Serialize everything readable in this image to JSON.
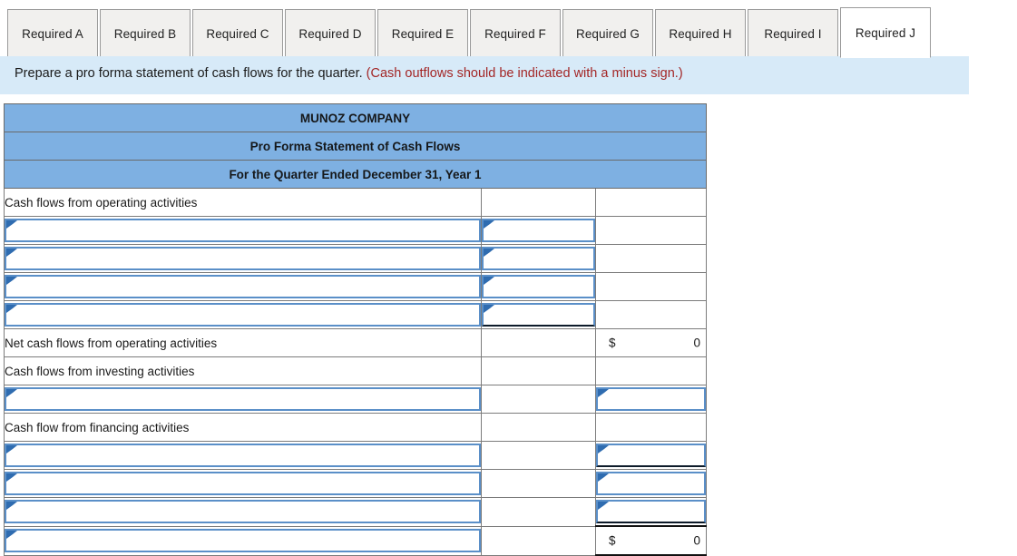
{
  "tabs": {
    "items": [
      {
        "label": "Required A",
        "active": false
      },
      {
        "label": "Required B",
        "active": false
      },
      {
        "label": "Required C",
        "active": false
      },
      {
        "label": "Required D",
        "active": false
      },
      {
        "label": "Required E",
        "active": false
      },
      {
        "label": "Required F",
        "active": false
      },
      {
        "label": "Required G",
        "active": false
      },
      {
        "label": "Required H",
        "active": false
      },
      {
        "label": "Required I",
        "active": false
      },
      {
        "label": "Required J",
        "active": true
      }
    ]
  },
  "instruction": {
    "text": "Prepare a pro forma statement of cash flows for the quarter. ",
    "note": "(Cash outflows should be indicated with a minus sign.)",
    "note_color": "#a32626",
    "background": "#d7eaf8"
  },
  "worksheet": {
    "header_color": "#7eb0e2",
    "titles": [
      "MUNOZ COMPANY",
      "Pro Forma Statement of Cash Flows",
      "For the Quarter Ended December 31, Year 1"
    ],
    "rows": [
      {
        "label": "Cash flows from operating activities",
        "kind": "text",
        "mid": "",
        "right": ""
      },
      {
        "label": "",
        "kind": "input",
        "mid": "input",
        "right": ""
      },
      {
        "label": "",
        "kind": "input",
        "mid": "input",
        "right": ""
      },
      {
        "label": "",
        "kind": "input",
        "mid": "input",
        "right": ""
      },
      {
        "label": "",
        "kind": "input",
        "mid": "input-last",
        "right": ""
      },
      {
        "label": "Net cash flows from operating activities",
        "kind": "text",
        "mid": "",
        "right": "money",
        "currency": "$",
        "amount": "0"
      },
      {
        "label": "Cash flows from investing activities",
        "kind": "text",
        "mid": "",
        "right": ""
      },
      {
        "label": "",
        "kind": "input",
        "mid": "",
        "right": "input"
      },
      {
        "label": "Cash flow from financing activities",
        "kind": "text",
        "mid": "",
        "right": ""
      },
      {
        "label": "",
        "kind": "input",
        "mid": "",
        "right": "input-underline"
      },
      {
        "label": "",
        "kind": "input",
        "mid": "",
        "right": "input"
      },
      {
        "label": "",
        "kind": "input",
        "mid": "",
        "right": "input-underline"
      },
      {
        "label": "",
        "kind": "input",
        "mid": "",
        "right": "money-total",
        "currency": "$",
        "amount": "0"
      }
    ]
  }
}
